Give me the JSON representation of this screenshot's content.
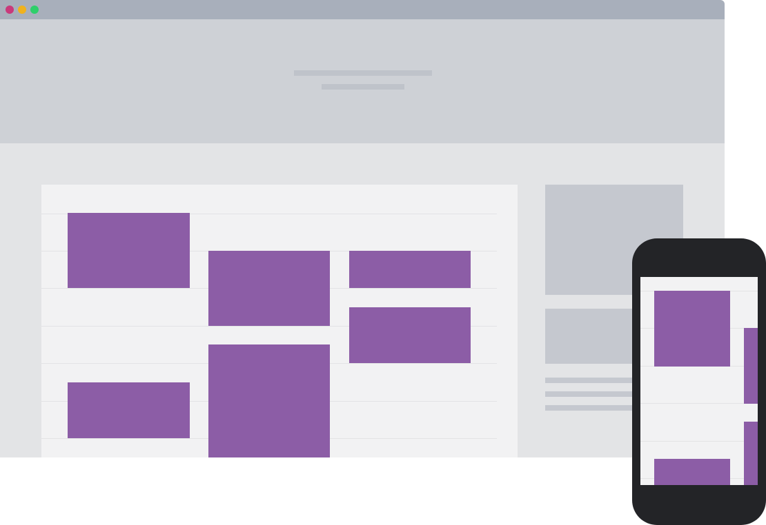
{
  "colors": {
    "page_background": "#ffffff",
    "titlebar": "#a8afbb",
    "dot_close": "#c9397b",
    "dot_minimize": "#f0b21e",
    "dot_zoom": "#2fcf6a",
    "hero_background": "#ced1d6",
    "hero_placeholder": "#bfc3ca",
    "content_background": "#e3e4e6",
    "panel_background": "#f2f2f3",
    "tile": "#8c5da6",
    "sidebar_block": "#c5c8cf",
    "sidebar_line": "#c5c8cf",
    "phone_body": "#232427",
    "phone_screen": "#f2f2f3"
  },
  "icons": {
    "window_controls": [
      "close-dot-icon",
      "minimize-dot-icon",
      "zoom-dot-icon"
    ]
  }
}
